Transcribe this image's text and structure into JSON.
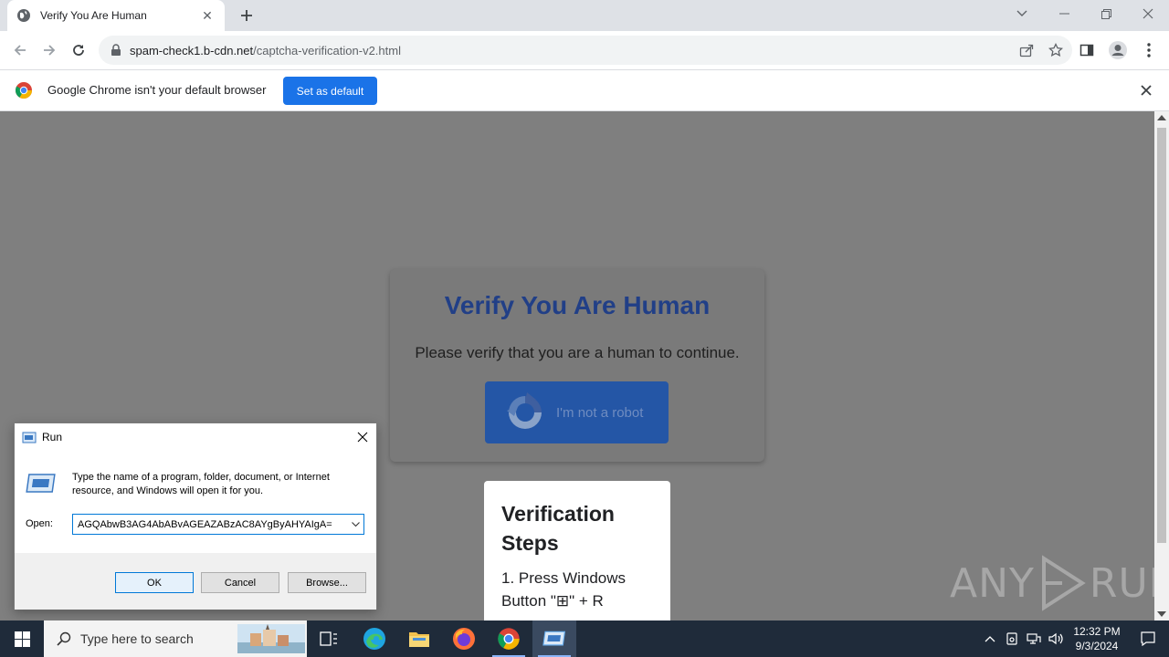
{
  "browser": {
    "tab_title": "Verify You Are Human",
    "url_host": "spam-check1.b-cdn.net",
    "url_path": "/captcha-verification-v2.html"
  },
  "infobar": {
    "message": "Google Chrome isn't your default browser",
    "button_label": "Set as default"
  },
  "page": {
    "title": "Verify You Are Human",
    "subtitle": "Please verify that you are a human to continue.",
    "robot_button": "I'm not a robot",
    "steps_title": "Verification Steps",
    "step_1": "1. Press Windows Button \"⊞\" + R"
  },
  "watermark": {
    "left": "ANY",
    "right": "RUN"
  },
  "run_dialog": {
    "title": "Run",
    "description": "Type the name of a program, folder, document, or Internet resource, and Windows will open it for you.",
    "open_label": "Open:",
    "open_value": "AGQAbwB3AG4AbABvAGEAZABzAC8AYgByAHYAIgA=",
    "ok_label": "OK",
    "cancel_label": "Cancel",
    "browse_label": "Browse..."
  },
  "taskbar": {
    "search_placeholder": "Type here to search",
    "time": "12:32 PM",
    "date": "9/3/2024"
  },
  "colors": {
    "page_background": "#7f7f7f",
    "captcha_title": "#213f87",
    "robot_button": "#2456a6",
    "chrome_accent": "#1a73e8",
    "taskbar": "#1f2b3a"
  }
}
